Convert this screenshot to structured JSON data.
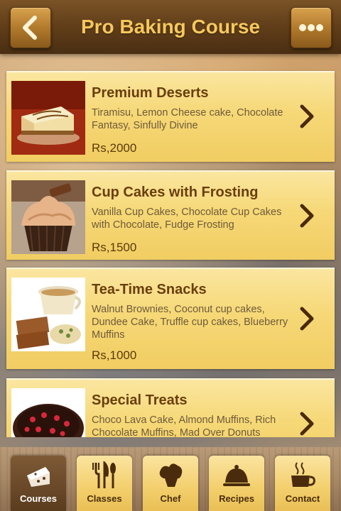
{
  "header": {
    "title": "Pro Baking Course",
    "back_icon": "chevron-left-icon",
    "more_icon": "more-dots-icon"
  },
  "courses": [
    {
      "title": "Premium Deserts",
      "description": "Tiramisu, Lemon Cheese cake, Chocolate Fantasy, Sinfully Divine",
      "price": "Rs,2000",
      "image": "cheesecake-image"
    },
    {
      "title": "Cup Cakes with Frosting",
      "description": "Vanilla Cup Cakes, Chocolate Cup Cakes with Chocolate, Fudge Frosting",
      "price": "Rs,1500",
      "image": "cupcake-image"
    },
    {
      "title": "Tea-Time Snacks",
      "description": "Walnut Brownies, Coconut cup cakes, Dundee Cake, Truffle cup cakes, Blueberry Muffins",
      "price": "Rs,1000",
      "image": "tea-snacks-image"
    },
    {
      "title": "Special Treats",
      "description": "Choco Lava Cake, Almond Muffins, Rich Chocolate Muffins, Mad Over Donuts",
      "price": "",
      "image": "chocolate-tart-image"
    }
  ],
  "tabs": [
    {
      "label": "Courses",
      "icon": "cake-slice-icon",
      "active": true
    },
    {
      "label": "Classes",
      "icon": "cutlery-icon",
      "active": false
    },
    {
      "label": "Chef",
      "icon": "chef-hat-icon",
      "active": false
    },
    {
      "label": "Recipes",
      "icon": "serving-cloche-icon",
      "active": false
    },
    {
      "label": "Contact",
      "icon": "coffee-cup-icon",
      "active": false
    }
  ],
  "colors": {
    "header_bg": "#5e3c18",
    "title_text": "#f6c85c",
    "card_bg": "#f6d877",
    "card_title": "#6a3e0c",
    "tab_active_bg": "#5a3c1e"
  }
}
